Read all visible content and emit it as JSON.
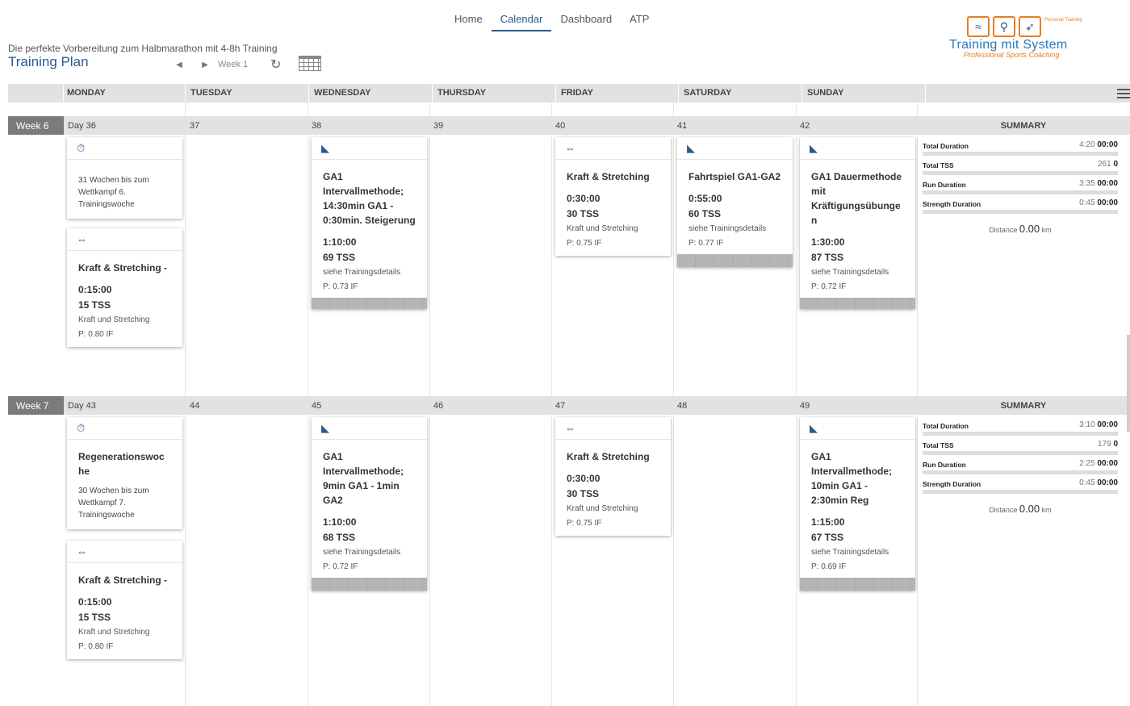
{
  "nav": {
    "items": [
      {
        "label": "Home",
        "active": false
      },
      {
        "label": "Calendar",
        "active": true
      },
      {
        "label": "Dashboard",
        "active": false
      },
      {
        "label": "ATP",
        "active": false
      }
    ]
  },
  "plan": {
    "subtitle": "Die perfekte Vorbereitung zum Halbmarathon mit 4-8h Training",
    "title": "Training Plan",
    "week_label": "Week 1",
    "prev_icon": "◀",
    "next_icon": "▶",
    "refresh_icon": "↻"
  },
  "logo": {
    "tag": "Personal Training",
    "brand": "Training mit System",
    "sub": "Professional Sports Coaching"
  },
  "days": [
    "MONDAY",
    "TUESDAY",
    "WEDNESDAY",
    "THURSDAY",
    "FRIDAY",
    "SATURDAY",
    "SUNDAY"
  ],
  "weeks": [
    {
      "label": "Week 6",
      "day_numbers": [
        "Day 36",
        "37",
        "38",
        "39",
        "40",
        "41",
        "42"
      ],
      "summary_title": "SUMMARY",
      "summary": {
        "total_duration_label": "Total Duration",
        "total_duration_plan": "4:20",
        "total_duration_done": "00:00",
        "total_tss_label": "Total TSS",
        "total_tss_plan": "261",
        "total_tss_done": "0",
        "run_duration_label": "Run Duration",
        "run_duration_plan": "3:35",
        "run_duration_done": "00:00",
        "strength_duration_label": "Strength Duration",
        "strength_duration_plan": "0:45",
        "strength_duration_done": "00:00",
        "distance_label": "Distance",
        "distance_value": "0.00",
        "distance_unit": "km"
      },
      "cards": [
        {
          "icon": "stopwatch-icon",
          "note": "31 Wochen bis zum Wettkampf 6. Trainingswoche"
        },
        {
          "icon": "dumbbell-icon",
          "title": "Kraft & Stretching -",
          "duration": "0:15:00",
          "tss": "15 TSS",
          "desc": "Kraft und Stretching",
          "if": "P: 0.80 IF"
        },
        {
          "icon": "shoe-icon",
          "title": "GA1 Intervallmethode; 14:30min GA1 - 0:30min. Steigerung",
          "duration": "1:10:00",
          "tss": "69 TSS",
          "desc": "siehe Trainingsdetails",
          "if": "P: 0.73 IF"
        },
        {
          "icon": "dumbbell-icon",
          "title": "Kraft & Stretching",
          "duration": "0:30:00",
          "tss": "30 TSS",
          "desc": "Kraft und Stretching",
          "if": "P: 0.75 IF"
        },
        {
          "icon": "shoe-icon",
          "title": "Fahrtspiel GA1-GA2",
          "duration": "0:55:00",
          "tss": "60 TSS",
          "desc": "siehe Trainingsdetails",
          "if": "P: 0.77 IF"
        },
        {
          "icon": "shoe-icon",
          "title": "GA1 Dauermethode mit Kräftigungsübunge n",
          "duration": "1:30:00",
          "tss": "87 TSS",
          "desc": "siehe Trainingsdetails",
          "if": "P: 0.72 IF"
        }
      ]
    },
    {
      "label": "Week 7",
      "day_numbers": [
        "Day 43",
        "44",
        "45",
        "46",
        "47",
        "48",
        "49"
      ],
      "summary_title": "SUMMARY",
      "summary": {
        "total_duration_label": "Total Duration",
        "total_duration_plan": "3:10",
        "total_duration_done": "00:00",
        "total_tss_label": "Total TSS",
        "total_tss_plan": "179",
        "total_tss_done": "0",
        "run_duration_label": "Run Duration",
        "run_duration_plan": "2:25",
        "run_duration_done": "00:00",
        "strength_duration_label": "Strength Duration",
        "strength_duration_plan": "0:45",
        "strength_duration_done": "00:00",
        "distance_label": "Distance",
        "distance_value": "0.00",
        "distance_unit": "km"
      },
      "cards": [
        {
          "icon": "stopwatch-icon",
          "title": "Regenerationswoc he",
          "note": "30 Wochen bis zum Wettkampf 7. Trainingswoche"
        },
        {
          "icon": "dumbbell-icon",
          "title": "Kraft & Stretching -",
          "duration": "0:15:00",
          "tss": "15 TSS",
          "desc": "Kraft und Stretching",
          "if": "P: 0.80 IF"
        },
        {
          "icon": "shoe-icon",
          "title": "GA1 Intervallmethode; 9min GA1 - 1min GA2",
          "duration": "1:10:00",
          "tss": "68 TSS",
          "desc": "siehe Trainingsdetails",
          "if": "P: 0.72 IF"
        },
        {
          "icon": "dumbbell-icon",
          "title": "Kraft & Stretching",
          "duration": "0:30:00",
          "tss": "30 TSS",
          "desc": "Kraft und Stretching",
          "if": "P: 0.75 IF"
        },
        {
          "icon": "shoe-icon",
          "title": "GA1 Intervallmethode; 10min GA1 - 2:30min Reg",
          "duration": "1:15:00",
          "tss": "67 TSS",
          "desc": "siehe Trainingsdetails",
          "if": "P: 0.69 IF"
        }
      ]
    }
  ]
}
